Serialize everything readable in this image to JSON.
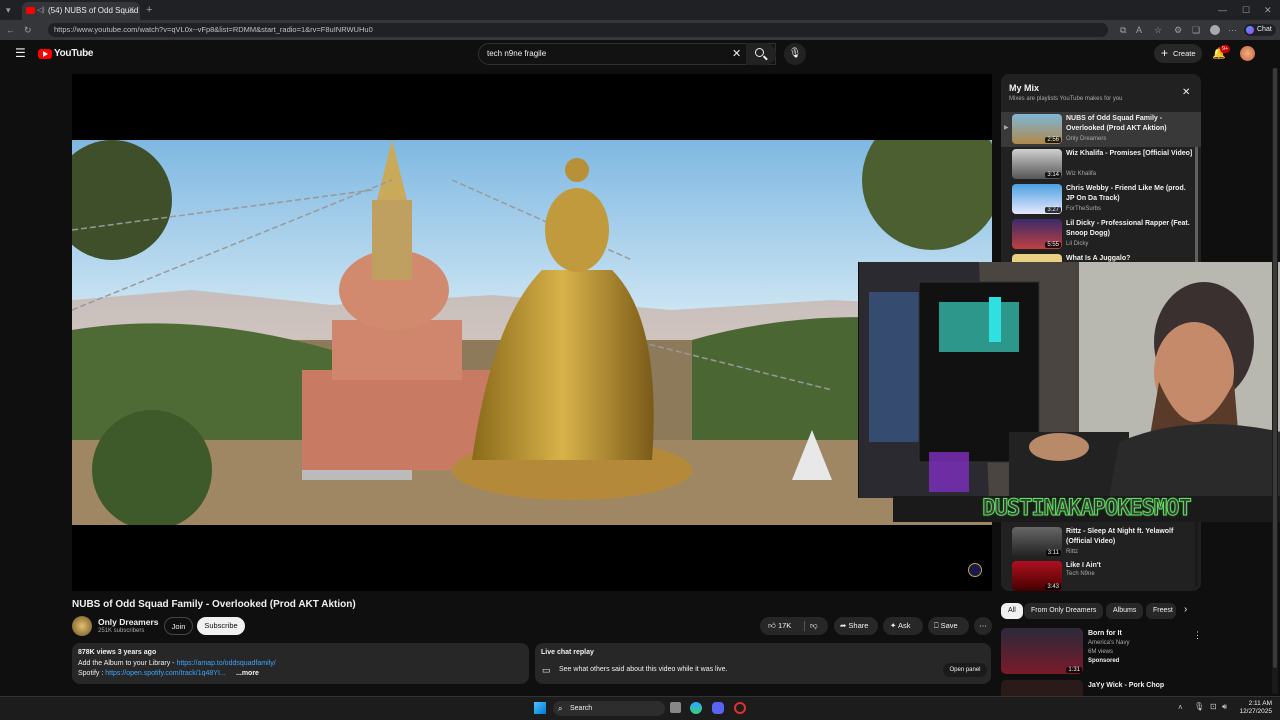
{
  "browser": {
    "tab_title": "(54) NUBS of Odd Squad Fami...",
    "url": "https://www.youtube.com/watch?v=qVL0x--vFp8&list=RDMM&start_radio=1&rv=F8uINRWUHu0",
    "profile_label": "Chat"
  },
  "header": {
    "logo_text": "YouTube",
    "search_value": "tech n9ne fragile",
    "create_label": "Create",
    "notif_count": "9+"
  },
  "video": {
    "title": "NUBS of Odd Squad Family - Overlooked (Prod AKT Aktion)"
  },
  "channel": {
    "name": "Only Dreamers",
    "subs": "251K subscribers",
    "join_label": "Join",
    "subscribe_label": "Subscribe"
  },
  "actions": {
    "likes": "17K",
    "share": "Share",
    "ask": "Ask",
    "save": "Save"
  },
  "description": {
    "meta": "878K views  3 years ago",
    "line1_prefix": "Add the Album to your Library - ",
    "line1_link": "https://amap.to/oddsquadfamily/",
    "line2_prefix": "Spotify : ",
    "line2_link": "https://open.spotify.com/track/1q48YI...",
    "more": "...more"
  },
  "chat_replay": {
    "title": "Live chat replay",
    "body": "See what others said about this video while it was live.",
    "open_panel": "Open panel"
  },
  "mix": {
    "title": "My Mix",
    "subtitle": "Mixes are playlists YouTube makes for you",
    "items": [
      {
        "title": "NUBS of Odd Squad Family - Overlooked (Prod AKT Aktion)",
        "artist": "Only Dreamers",
        "duration": "2:56"
      },
      {
        "title": "Wiz Khalifa - Promises [Official Video]",
        "artist": "Wiz Khalifa",
        "duration": "3:14"
      },
      {
        "title": "Chris Webby - Friend Like Me (prod. JP On Da Track)",
        "artist": "ForTheSurbs",
        "duration": "3:27"
      },
      {
        "title": "Lil Dicky - Professional Rapper (Feat. Snoop Dogg)",
        "artist": "Lil Dicky",
        "duration": "5:55"
      },
      {
        "title": "What Is A Juggalo?",
        "artist": "",
        "duration": ""
      },
      {
        "title": "Rittz - Sleep At Night ft. Yelawolf (Official Video)",
        "artist": "Rittz",
        "duration": "3:11"
      },
      {
        "title": "Like I Ain't",
        "artist": "Tech N9ne",
        "duration": "3:43"
      }
    ]
  },
  "chips": [
    "All",
    "From Only Dreamers",
    "Albums",
    "Freest"
  ],
  "recs": [
    {
      "title": "Born for It",
      "channel": "America's Navy",
      "views": "6M views",
      "badge": "Sponsored",
      "duration": "1:31"
    },
    {
      "title": "JaYy Wick - Pork Chop",
      "channel": "",
      "views": "",
      "badge": "",
      "duration": ""
    }
  ],
  "webcam": {
    "banner": "DUSTINAKAPOKESMOT"
  },
  "taskbar": {
    "search": "Search",
    "time": "2:11 AM",
    "date": "12/27/2025"
  },
  "colors": {
    "yt_red": "#ff0000",
    "link_blue": "#3ea6ff",
    "banner_green": "#5de05d"
  }
}
